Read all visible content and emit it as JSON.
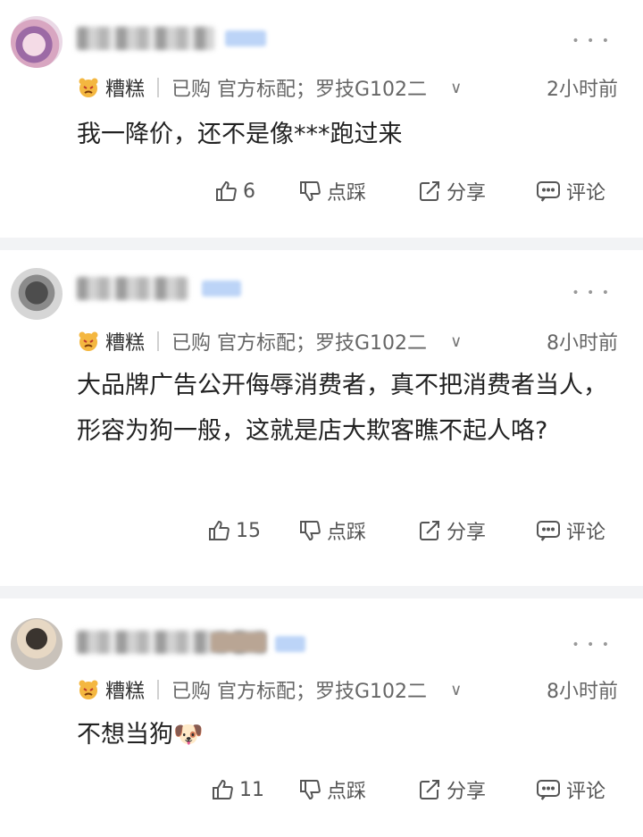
{
  "comments": [
    {
      "purchase_info": "已购 官方标配；罗技G102二",
      "time": "2小时前",
      "text": "我一降价，还不是像***跑过来",
      "like_count": "6",
      "dislike_label": "点踩",
      "share_label": "分享",
      "comment_label": "评论"
    },
    {
      "purchase_info": "已购 官方标配；罗技G102二",
      "time": "8小时前",
      "text": "大品牌广告公开侮辱消费者，真不把消费者当人，形容为狗一般，这就是店大欺客瞧不起人咯?",
      "like_count": "15",
      "dislike_label": "点踩",
      "share_label": "分享",
      "comment_label": "评论"
    },
    {
      "purchase_info": "已购 官方标配；罗技G102二",
      "time": "8小时前",
      "text": "不想当狗🐶",
      "like_count": "11",
      "dislike_label": "点踩",
      "share_label": "分享",
      "comment_label": "评论"
    }
  ],
  "user_label": "糟糕",
  "more_glyph": "• • •",
  "chevron": "∨",
  "colors": {
    "divider_band": "#f2f3f5",
    "blur_tag": "#bcd4f7",
    "text": "#222222",
    "meta": "#666666"
  }
}
